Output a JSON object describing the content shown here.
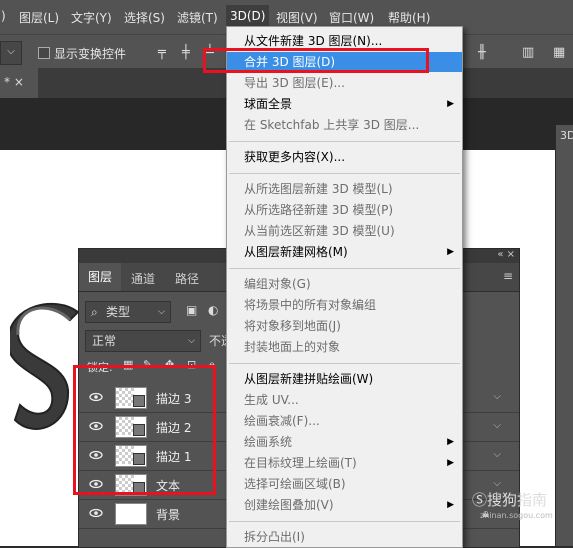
{
  "menubar": {
    "items": [
      ")",
      "图层(L)",
      "文字(Y)",
      "选择(S)",
      "滤镜(T)",
      "3D(D)",
      "视图(V)",
      "窗口(W)",
      "帮助(H)"
    ],
    "active": "3D(D)"
  },
  "options_bar": {
    "dropdown_glyph": "⌵",
    "show_transform_label": "显示变换控件"
  },
  "doc_tab": {
    "close": "* ×"
  },
  "right_panel": {
    "label": "3D"
  },
  "menu_3d": {
    "items": [
      {
        "label": "从文件新建 3D 图层(N)...",
        "enabled": true
      },
      {
        "label": "合并 3D 图层(D)",
        "enabled": true,
        "highlighted": true
      },
      {
        "label": "导出 3D 图层(E)...",
        "enabled": false
      },
      {
        "label": "球面全景",
        "enabled": true,
        "submenu": true
      },
      {
        "label": "在 Sketchfab 上共享 3D 图层...",
        "enabled": false
      },
      {
        "label": "获取更多内容(X)...",
        "enabled": true
      },
      {
        "label": "从所选图层新建 3D 模型(L)",
        "enabled": false
      },
      {
        "label": "从所选路径新建 3D 模型(P)",
        "enabled": false
      },
      {
        "label": "从当前选区新建 3D 模型(U)",
        "enabled": false
      },
      {
        "label": "从图层新建网格(M)",
        "enabled": true,
        "submenu": true
      },
      {
        "label": "编组对象(G)",
        "enabled": false
      },
      {
        "label": "将场景中的所有对象编组",
        "enabled": false
      },
      {
        "label": "将对象移到地面(J)",
        "enabled": false
      },
      {
        "label": "封装地面上的对象",
        "enabled": false
      },
      {
        "label": "从图层新建拼贴绘画(W)",
        "enabled": true
      },
      {
        "label": "生成 UV...",
        "enabled": false
      },
      {
        "label": "绘画衰减(F)...",
        "enabled": false
      },
      {
        "label": "绘画系统",
        "enabled": false,
        "submenu": true
      },
      {
        "label": "在目标纹理上绘画(T)",
        "enabled": false,
        "submenu": true
      },
      {
        "label": "选择可绘画区域(B)",
        "enabled": false
      },
      {
        "label": "创建绘图叠加(V)",
        "enabled": false,
        "submenu": true
      },
      {
        "label": "拆分凸出(I)",
        "enabled": false
      }
    ]
  },
  "layers_panel": {
    "collapse": "«  ×",
    "tabs": [
      "图层",
      "通道",
      "路径"
    ],
    "filter_label": "类型",
    "blend_mode": "正常",
    "opacity_label": "不透",
    "lock_label": "锁定:",
    "layers": [
      {
        "name": "描边 3",
        "type": "3d"
      },
      {
        "name": "描边 2",
        "type": "3d"
      },
      {
        "name": "描边 1",
        "type": "3d"
      },
      {
        "name": "文本",
        "type": "3d"
      },
      {
        "name": "背景",
        "type": "fill"
      }
    ]
  },
  "watermark": {
    "text": "搜狗指南",
    "sub": "zhinan.sogou.com"
  },
  "colors": {
    "highlight": "#3a8ee6",
    "red_annotation": "#e8131f",
    "panel_bg": "#535353"
  }
}
